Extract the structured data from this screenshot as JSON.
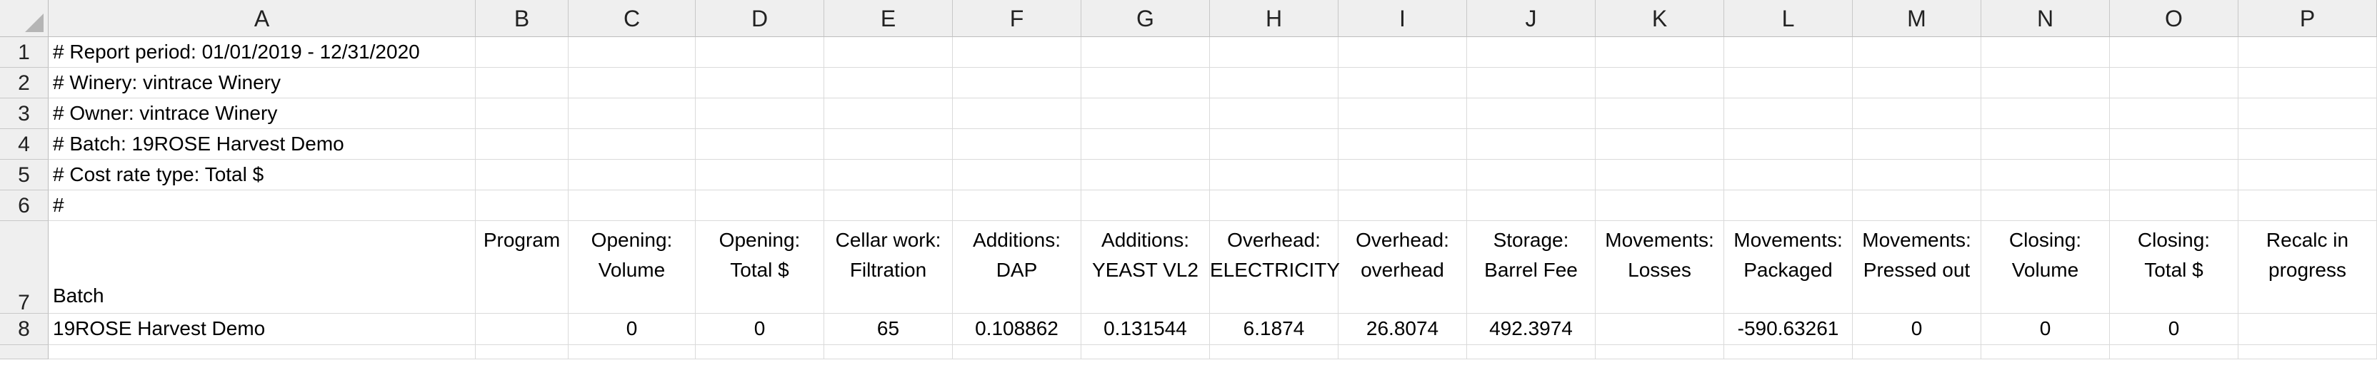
{
  "columns": [
    "A",
    "B",
    "C",
    "D",
    "E",
    "F",
    "G",
    "H",
    "I",
    "J",
    "K",
    "L",
    "M",
    "N",
    "O",
    "P"
  ],
  "rows": [
    "1",
    "2",
    "3",
    "4",
    "5",
    "6",
    "7",
    "8"
  ],
  "meta_lines": [
    "#  Report period: 01/01/2019 - 12/31/2020",
    "#  Winery: vintrace Winery",
    "#  Owner: vintrace Winery",
    "#  Batch: 19ROSE Harvest Demo",
    "#  Cost rate type: Total $",
    "#"
  ],
  "header_row": {
    "A": "Batch",
    "B": "Program",
    "C": "Opening:\nVolume",
    "D": "Opening:\nTotal $",
    "E": "Cellar work:\nFiltration",
    "F": "Additions:\nDAP",
    "G": "Additions:\nYEAST VL2",
    "H": "Overhead:\nELECTRICITY",
    "I": "Overhead:\noverhead",
    "J": "Storage:\nBarrel Fee",
    "K": "Movements:\nLosses",
    "L": "Movements:\nPackaged",
    "M": "Movements:\nPressed out",
    "N": "Closing:\nVolume",
    "O": "Closing:\nTotal $",
    "P": "Recalc in\nprogress"
  },
  "data_row": {
    "A": "19ROSE Harvest Demo",
    "B": "",
    "C": "0",
    "D": "0",
    "E": "65",
    "F": "0.108862",
    "G": "0.131544",
    "H": "6.1874",
    "I": "26.8074",
    "J": "492.3974",
    "K": "",
    "L": "-590.63261",
    "M": "0",
    "N": "0",
    "O": "0",
    "P": ""
  }
}
